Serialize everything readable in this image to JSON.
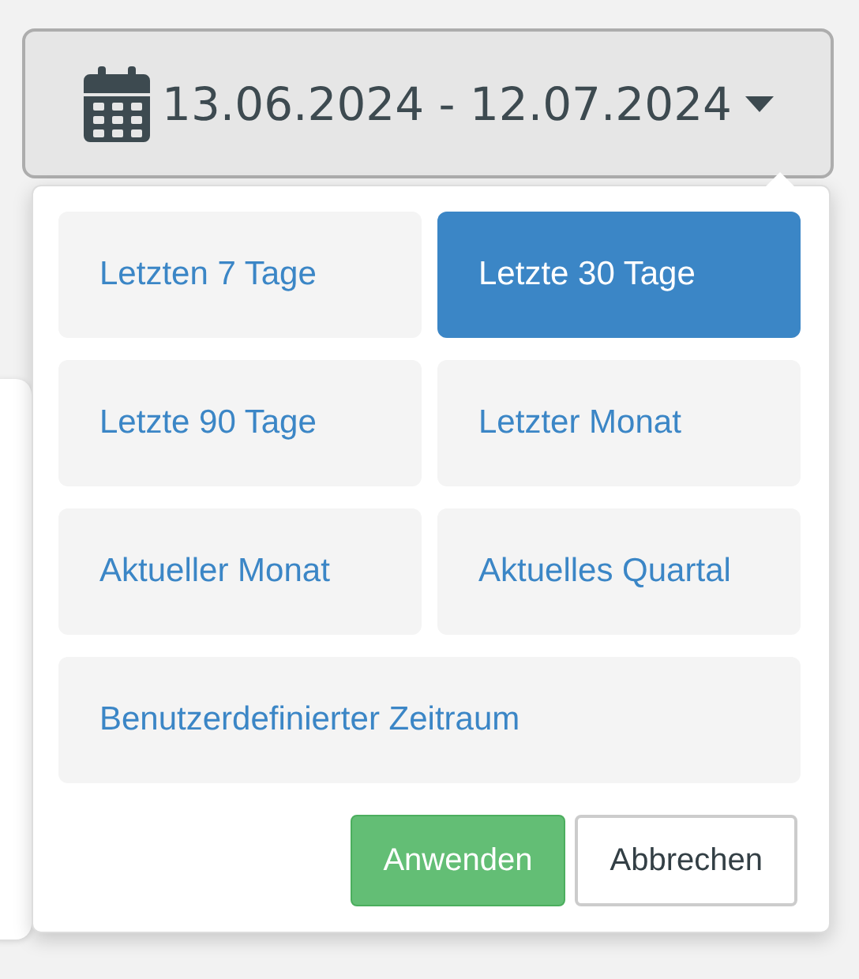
{
  "date_button": {
    "label": "13.06.2024 - 12.07.2024"
  },
  "ranges": [
    {
      "label": "Letzten 7 Tage",
      "selected": false,
      "kind": "half"
    },
    {
      "label": "Letzte 30 Tage",
      "selected": true,
      "kind": "half"
    },
    {
      "label": "Letzte 90 Tage",
      "selected": false,
      "kind": "half"
    },
    {
      "label": "Letzter Monat",
      "selected": false,
      "kind": "half"
    },
    {
      "label": "Aktueller Monat",
      "selected": false,
      "kind": "half"
    },
    {
      "label": "Aktuelles Quartal",
      "selected": false,
      "kind": "half"
    },
    {
      "label": "Benutzerdefinierter Zeitraum",
      "selected": false,
      "kind": "full"
    }
  ],
  "actions": [
    {
      "label": "Anwenden",
      "kind": "primary"
    },
    {
      "label": "Abbrechen",
      "kind": "secondary"
    }
  ]
}
